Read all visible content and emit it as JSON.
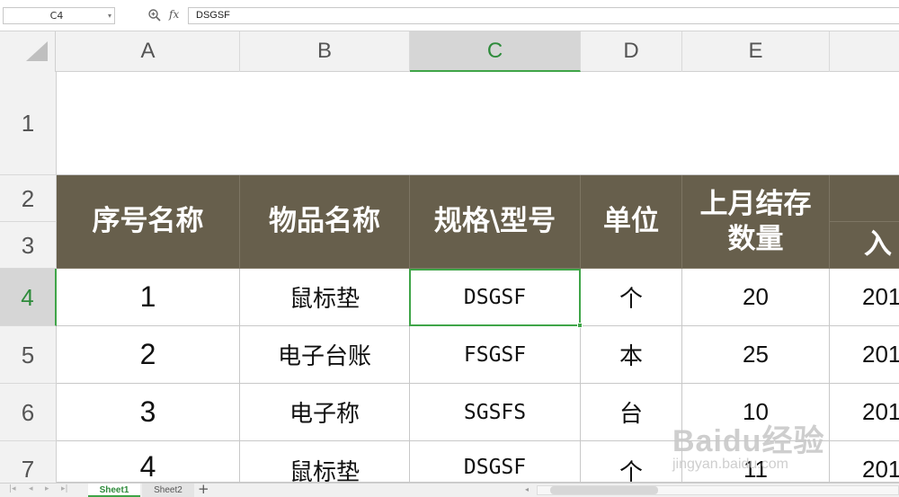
{
  "formula_bar": {
    "name_box": "C4",
    "fx_label": "fx",
    "formula": "DSGSF"
  },
  "columns": [
    "A",
    "B",
    "C",
    "D",
    "E"
  ],
  "rows": [
    "1",
    "2",
    "3",
    "4",
    "5",
    "6",
    "7"
  ],
  "header": {
    "seq_name": "序号名称",
    "item_name": "物品名称",
    "spec_model": "规格\\型号",
    "unit": "单位",
    "last_month_stock_line1": "上月结存",
    "last_month_stock_line2": "数量",
    "inbound_partial": "入"
  },
  "data_rows": [
    {
      "no": "1",
      "name": "鼠标垫",
      "spec": "DSGSF",
      "unit": "个",
      "qty": "20",
      "date": "201"
    },
    {
      "no": "2",
      "name": "电子台账",
      "spec": "FSGSF",
      "unit": "本",
      "qty": "25",
      "date": "201"
    },
    {
      "no": "3",
      "name": "电子称",
      "spec": "SGSFS",
      "unit": "台",
      "qty": "10",
      "date": "201"
    },
    {
      "no": "4",
      "name": "鼠标垫",
      "spec": "DSGSF",
      "unit": "个",
      "qty": "11",
      "date": "201"
    }
  ],
  "sheet_tabs": [
    "Sheet1",
    "Sheet2"
  ],
  "add_sheet": "+",
  "watermark": {
    "brand": "Baidu经验",
    "url": "jingyan.baidu.com"
  },
  "colors": {
    "header_bg": "#675f4c",
    "accent": "#3fa548"
  }
}
